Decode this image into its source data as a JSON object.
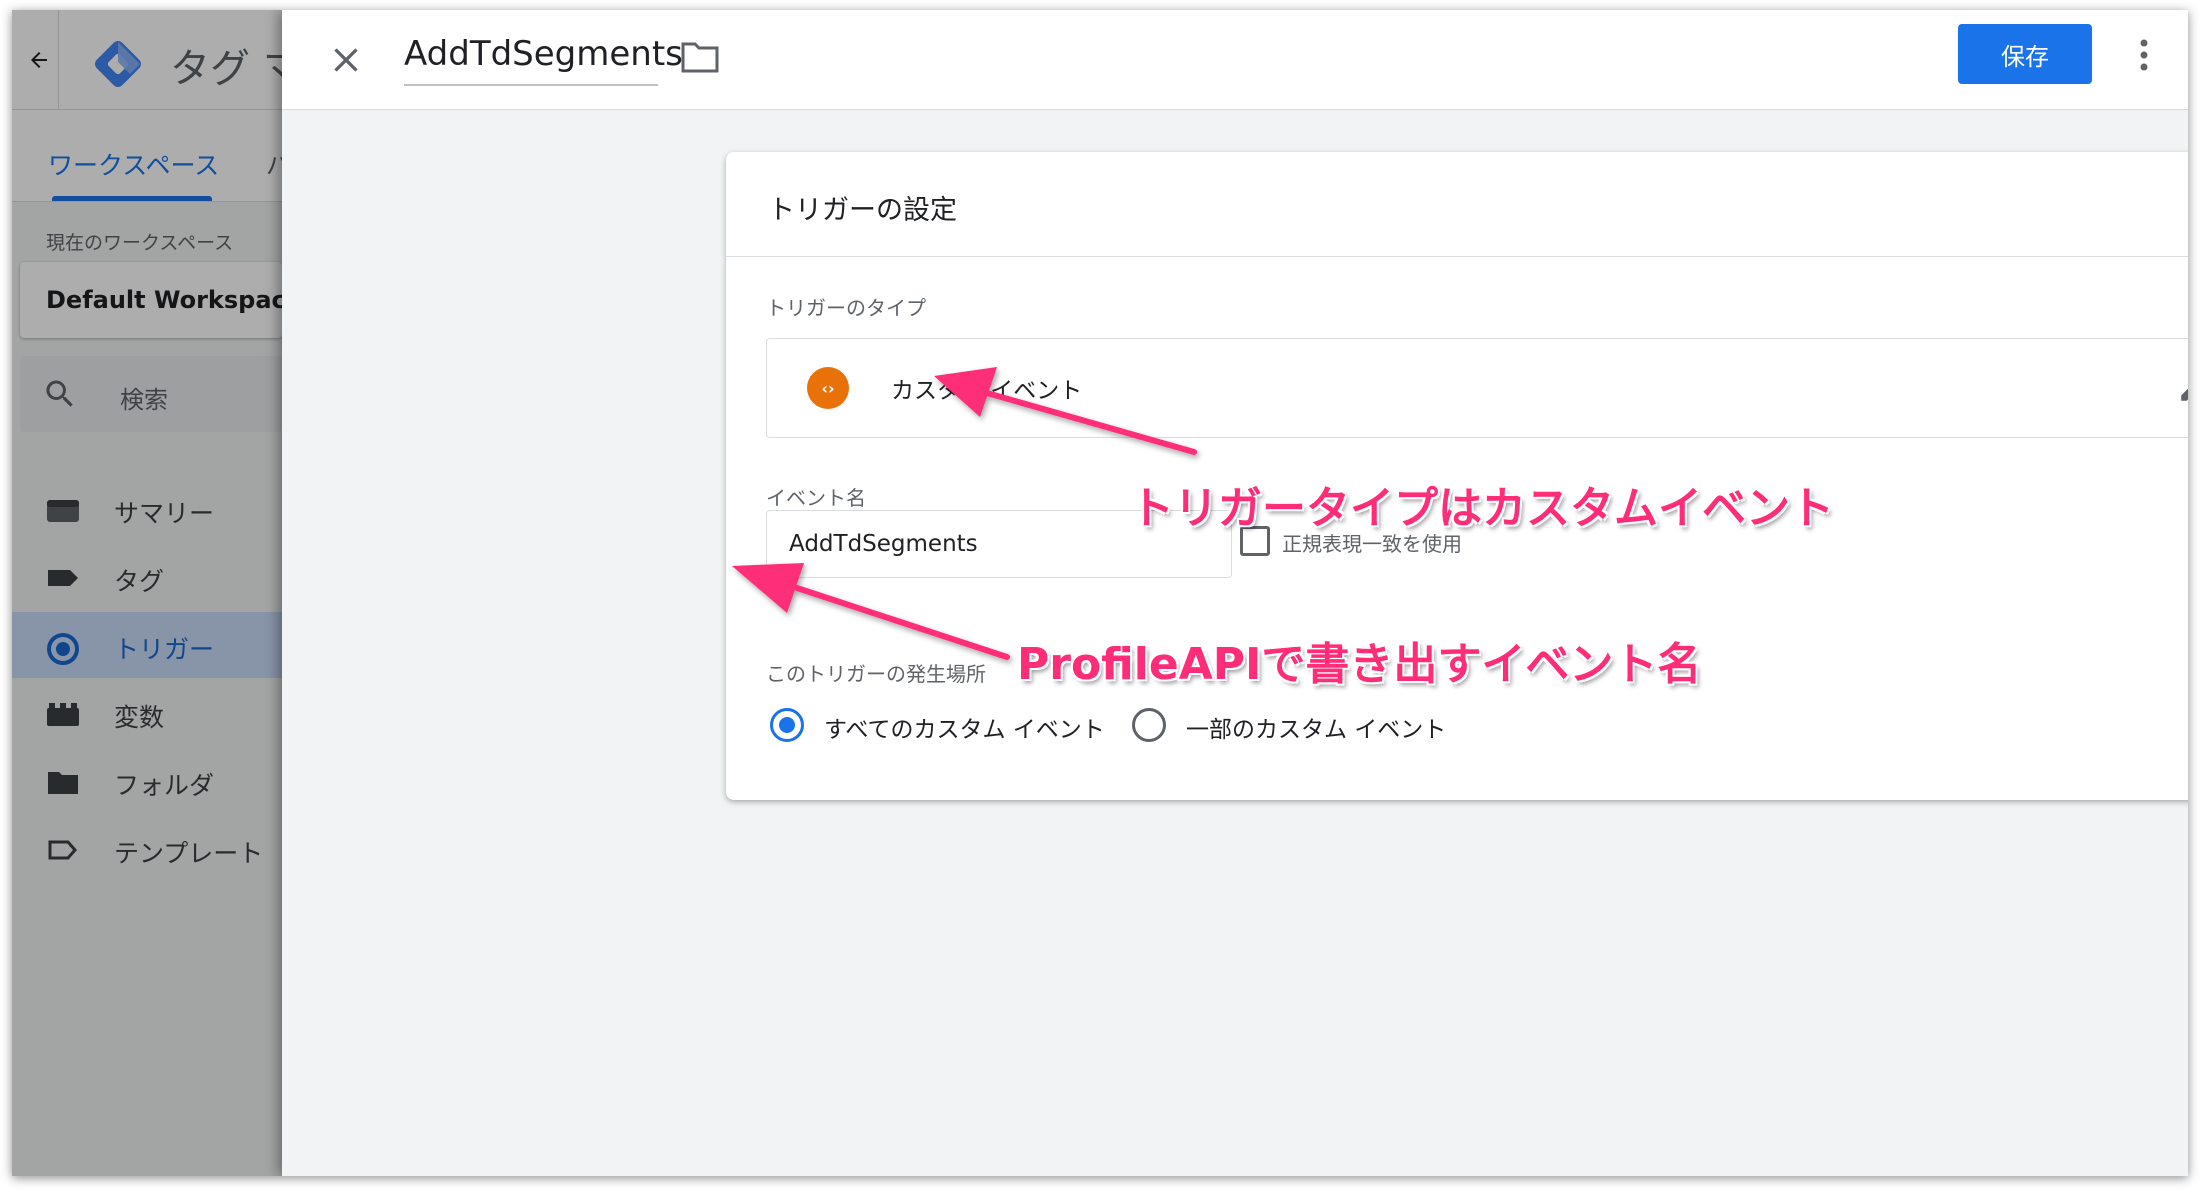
{
  "app": {
    "title": "タグ マ",
    "tabs": [
      "ワークスペース",
      "バ"
    ],
    "workspace_label": "現在のワークスペース",
    "workspace_name": "Default Workspace",
    "search_label": "検索",
    "nav": [
      {
        "label": "サマリー",
        "icon": "summary-icon"
      },
      {
        "label": "タグ",
        "icon": "tag-icon"
      },
      {
        "label": "トリガー",
        "icon": "trigger-icon",
        "active": true
      },
      {
        "label": "変数",
        "icon": "variables-icon"
      },
      {
        "label": "フォルダ",
        "icon": "folder-icon"
      },
      {
        "label": "テンプレート",
        "icon": "template-icon"
      }
    ]
  },
  "panel": {
    "name": "AddTdSegments",
    "save_label": "保存"
  },
  "card": {
    "title": "トリガーの設定",
    "type_label": "トリガーのタイプ",
    "type_name": "カスタム イベント",
    "event_name_label": "イベント名",
    "event_name_value": "AddTdSegments",
    "regex_label": "正規表現一致を使用",
    "fires_on_label": "このトリガーの発生場所",
    "options": [
      {
        "label": "すべてのカスタム イベント",
        "selected": true
      },
      {
        "label": "一部のカスタム イベント",
        "selected": false
      }
    ]
  },
  "annotations": {
    "type_note": "トリガータイプはカスタムイベント",
    "event_note": "ProfileAPIで書き出すイベント名"
  },
  "colors": {
    "accent": "#1a73e8",
    "annotation": "#ff2d78",
    "custom_event_icon": "#e8710a"
  }
}
